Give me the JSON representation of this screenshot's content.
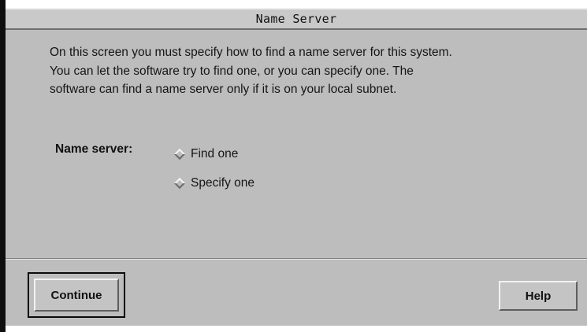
{
  "window": {
    "title": "Name Server"
  },
  "intro": {
    "lines": [
      "On this screen you must specify how to find a name server for this system.",
      "You can let the software try to find one, or you can specify one.  The",
      "software can find a name server only if it is on your local subnet."
    ]
  },
  "name_server": {
    "label": "Name server:",
    "options": [
      {
        "label": "Find one",
        "selected": false
      },
      {
        "label": "Specify one",
        "selected": false
      }
    ]
  },
  "buttons": {
    "continue_label": "Continue",
    "help_label": "Help"
  },
  "colors": {
    "background": "#bdbdbd",
    "window_frame": "#0e0e0e",
    "text": "#151515"
  }
}
